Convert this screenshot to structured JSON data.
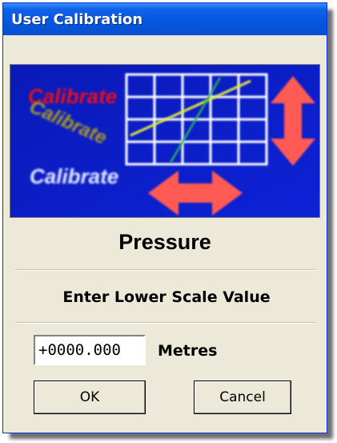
{
  "window": {
    "title": "User Calibration"
  },
  "banner": {
    "words": [
      "Calibrate",
      "Calibrate",
      "Calibrate"
    ],
    "colors": {
      "background": "#0a1cc8",
      "red_text": "#e8101c",
      "gold_text": "#a89a2a",
      "white_text": "#e6eaff",
      "grid": "#ffffff",
      "yellow_line": "#e6ea3a",
      "green_line": "#28b060",
      "arrow": "#ff5a52"
    }
  },
  "main": {
    "heading": "Pressure",
    "instruction": "Enter Lower Scale Value",
    "value": "+0000.000",
    "unit": "Metres"
  },
  "buttons": {
    "ok_label": "OK",
    "cancel_label": "Cancel"
  }
}
